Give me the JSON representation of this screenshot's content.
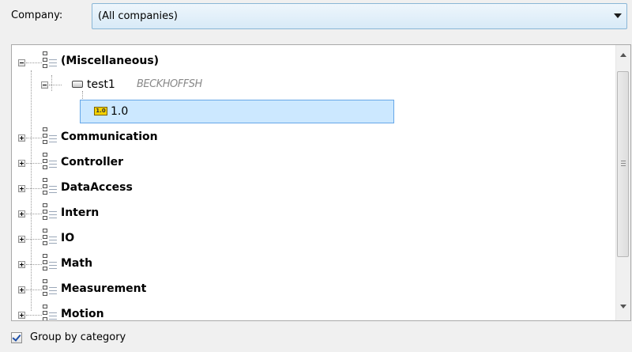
{
  "company_filter": {
    "label": "Company:",
    "selected": "(All companies)"
  },
  "tree": {
    "misc_category": {
      "label": "(Miscellaneous)",
      "device": {
        "name": "test1",
        "vendor": "BECKHOFFSH",
        "version": {
          "icon_text": "1.0",
          "label": "1.0",
          "selected": true
        }
      }
    },
    "categories": [
      {
        "label": "Communication"
      },
      {
        "label": "Controller"
      },
      {
        "label": "DataAccess"
      },
      {
        "label": "Intern"
      },
      {
        "label": "IO"
      },
      {
        "label": "Math"
      },
      {
        "label": "Measurement"
      },
      {
        "label": "Motion"
      }
    ]
  },
  "group_by_category": {
    "label": "Group by category",
    "checked": true
  }
}
